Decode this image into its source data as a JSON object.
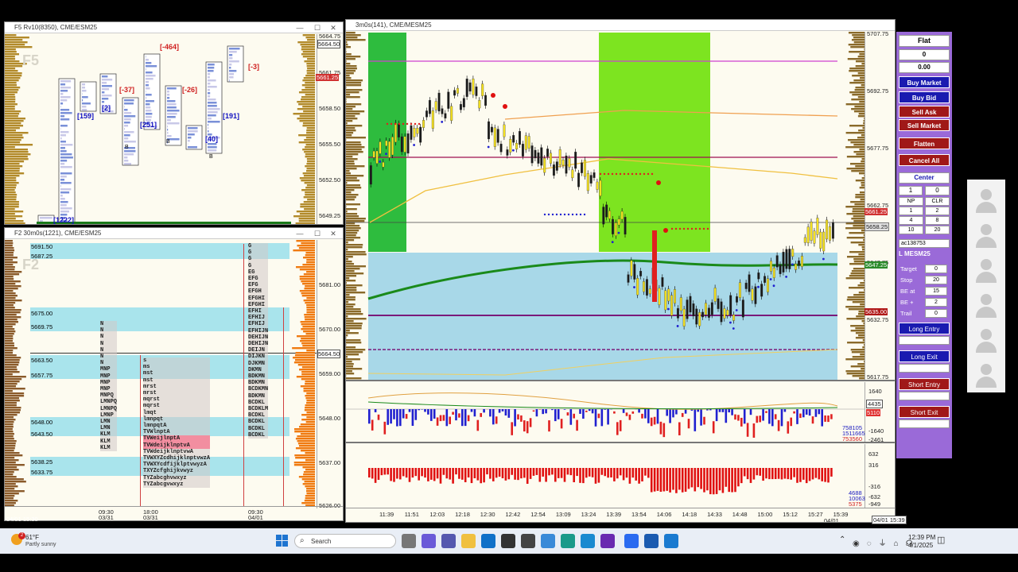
{
  "win_f5": {
    "title": "F5 Rv10(8350), CME/ESM25",
    "wm": "F5",
    "prices": [
      "5664.75",
      "5661.75",
      "5658.50",
      "5655.50",
      "5652.50",
      "5649.25"
    ],
    "price_tags": [
      "5664.50",
      "5661.25"
    ],
    "deltas": [
      "[-464]",
      "[-37]",
      "[-3]",
      "[-26]",
      "[159]",
      "[2]",
      "[251]",
      "[40]",
      "[191]",
      "[1222]"
    ],
    "b_marks": [
      "B",
      "B",
      "B"
    ]
  },
  "win_f2": {
    "title": "F2 30m0s(1221), CME/ESM25",
    "wm": "F2",
    "levels": [
      "5691.50",
      "5687.25",
      "5675.00",
      "5669.75",
      "5663.50",
      "5657.75",
      "5648.00",
      "5643.50",
      "5638.25",
      "5633.75"
    ],
    "prices": [
      "5681.00",
      "5670.00",
      "5659.00",
      "5648.00",
      "5637.00",
      "5626.00"
    ],
    "price_tag": "5664.50",
    "dates": [
      "09:30",
      "03/31",
      "18:00",
      "03/31",
      "09:30",
      "04/01"
    ],
    "footer": "04/01 15:30",
    "profile_rows": [
      "N",
      "N",
      "N",
      "N",
      "N",
      "N",
      "N",
      "MNP",
      "MNP",
      "MNP",
      "MNP",
      "MNPQ",
      "LMNPQ",
      "LMNPQ",
      "LMNP",
      "LMN",
      "LMN",
      "KLM",
      "KLM",
      "KLM"
    ],
    "profile2_rows": [
      "s",
      "ms",
      "mst",
      "mst",
      "mrst",
      "mrst",
      "mqrst",
      "mqrst",
      "lmqt",
      "lmnpqt",
      "lmnpqtA",
      "TVWlnptA",
      "TVWeijlnptA",
      "TVWdeijklnptvA",
      "TVWdeijklnptvwA",
      "TVWXYZcdhijklnptvwzA",
      "TVWXYcdfijklptvwyzA",
      "TXYZcfghijkvwyz",
      "TYZabcghvwxyz",
      "TYZabcgvwxyz"
    ],
    "profile3_rows": [
      "G",
      "G",
      "G",
      "G",
      "EG",
      "EFG",
      "EFG",
      "EFGH",
      "EFGHI",
      "EFGHI",
      "EFHI",
      "EFHIJ",
      "EFHIJ",
      "EFHIJN",
      "DEHIJN",
      "DEHIJN",
      "DEIJN",
      "DIJKN",
      "DJKMN",
      "DKMN",
      "BDKMN",
      "BDKMN",
      "BCDKMN",
      "BDKMN",
      "BCDKL",
      "BCDKLM",
      "BCDKL",
      "BCDKL",
      "BCDKL",
      "BCDKL"
    ]
  },
  "win_main": {
    "title": "3m0s(141), CME/MESM25",
    "prices": [
      "5707.75",
      "5692.75",
      "5677.75",
      "5662.75",
      "5647.75",
      "5632.75",
      "5617.75"
    ],
    "tags": [
      {
        "t": "5661.25",
        "c": "#d03030"
      },
      {
        "t": "5658.25",
        "c": "#e0e0e0"
      },
      {
        "t": "5647.25",
        "c": "#2a8a2a"
      },
      {
        "t": "5635.00",
        "c": "#b01818"
      }
    ],
    "ind1": [
      "1640",
      "4435",
      "5110",
      "-1640",
      "-2461"
    ],
    "ind1_values": [
      "758105",
      "1511665",
      "753560"
    ],
    "ind2": [
      "632",
      "316",
      "-316",
      "-632",
      "-949"
    ],
    "ind2_values": [
      "4688",
      "10063",
      "5375"
    ],
    "times": [
      "11:39",
      "11:51",
      "12:03",
      "12:18",
      "12:30",
      "12:42",
      "12:54",
      "13:09",
      "13:24",
      "13:39",
      "13:54",
      "14:06",
      "14:18",
      "14:33",
      "14:48",
      "15:00",
      "15:12",
      "15:27",
      "15:39"
    ],
    "last_date": "04/01",
    "footer": "04/01 15:39",
    "marks": [
      "B",
      "B",
      "B",
      "B",
      "B",
      "B",
      "B",
      "B",
      "s",
      "s",
      "s",
      "s",
      "s",
      "s",
      "s",
      "s",
      "s"
    ]
  },
  "panel": {
    "status": "Flat",
    "qty": "0",
    "pnl": "0.00",
    "buttons": [
      "Buy Market",
      "Buy Bid",
      "Sell Ask",
      "Sell Market",
      "Flatten",
      "Cancel All"
    ],
    "center": "Center",
    "qty_in": "1",
    "qty_b": "0",
    "grid": [
      "NP",
      "CLR",
      "1",
      "2",
      "4",
      "8",
      "10",
      "20"
    ],
    "account": "ac138753",
    "instrument": "L MESM25",
    "fields": [
      {
        "label": "Target",
        "value": "0"
      },
      {
        "label": "Stop",
        "value": "20"
      },
      {
        "label": "BE at",
        "value": "15"
      },
      {
        "label": "BE +",
        "value": "2"
      },
      {
        "label": "Trail",
        "value": "0"
      }
    ],
    "entries": [
      "Long Entry",
      "Long Exit",
      "Short Entry",
      "Short Exit"
    ]
  },
  "taskbar": {
    "weather_temp": "61°F",
    "weather_desc": "Partly sunny",
    "search": "Search",
    "time": "12:39 PM",
    "date": "4/1/2025",
    "badge": "2"
  }
}
